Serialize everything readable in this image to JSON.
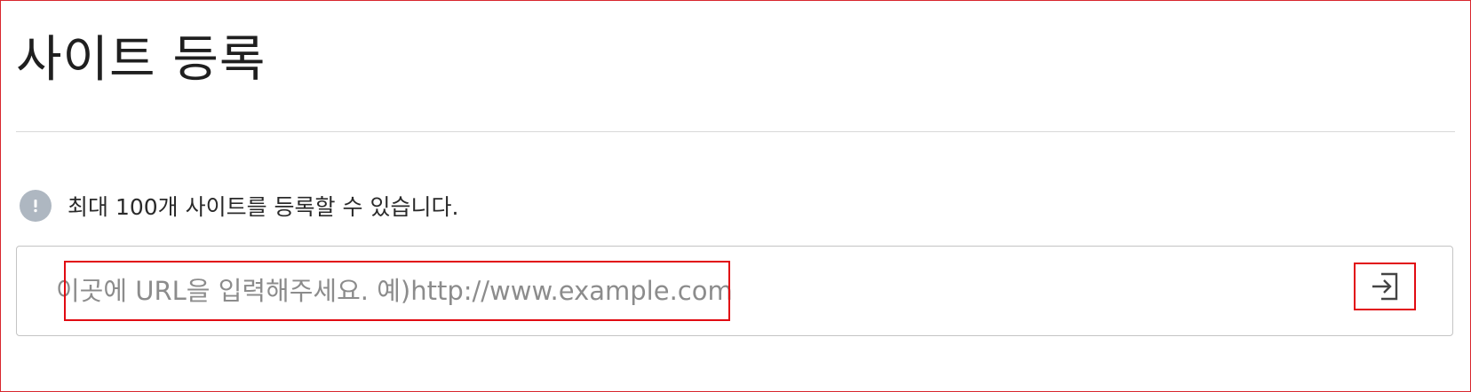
{
  "page": {
    "title": "사이트 등록"
  },
  "notice": {
    "icon": "exclamation-icon",
    "text": "최대 100개 사이트를 등록할 수 있습니다."
  },
  "url_input": {
    "value": "",
    "placeholder": "이곳에 URL을 입력해주세요. 예)http://www.example.com"
  },
  "submit": {
    "icon": "enter-arrow-icon"
  },
  "colors": {
    "frame_border": "#d8262e",
    "highlight": "#e10b12",
    "notice_icon_bg": "#aeb7c1",
    "input_border": "#c4c4c4",
    "placeholder": "#8c8c8c"
  }
}
